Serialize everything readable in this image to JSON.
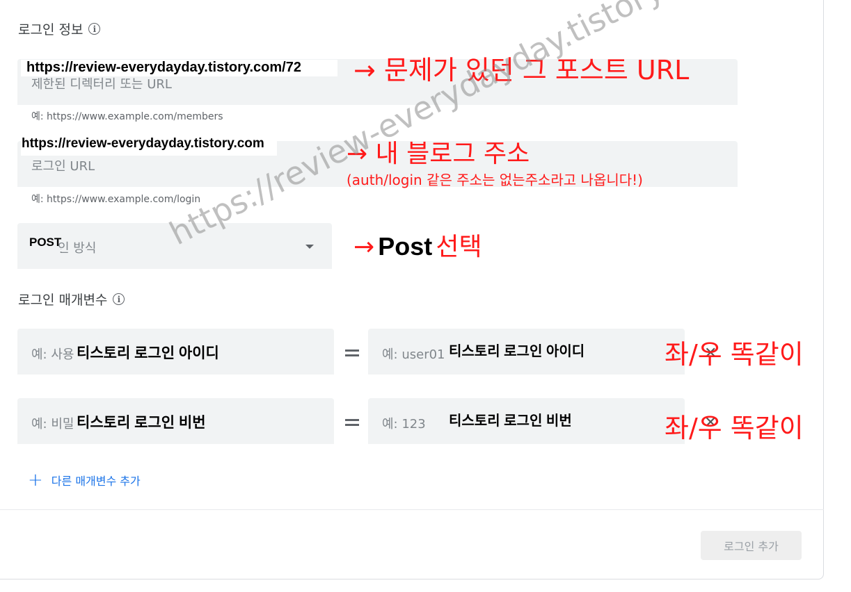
{
  "login_info": {
    "title": "로그인 정보",
    "restricted_dir": {
      "placeholder": "제한된 디렉터리 또는 URL",
      "helper": "예: https://www.example.com/members",
      "overlay_value": "https://review-everydayday.tistory.com/72",
      "annotation": "→ 문제가 있던 그 포스트 URL"
    },
    "login_url": {
      "placeholder": "로그인 URL",
      "helper": "예: https://www.example.com/login",
      "overlay_value": "https://review-everydayday.tistory.com",
      "annotation": "→ 내 블로그 주소",
      "annotation_note": "(auth/login 같은 주소는 없는주소라고 나옵니다!)"
    },
    "login_method": {
      "placeholder_visible": "인 방식",
      "overlay_value": "POST",
      "annotation_arrow": "→",
      "annotation_bold": "Post",
      "annotation_red": "선택"
    }
  },
  "login_params": {
    "title": "로그인 매개변수",
    "rows": [
      {
        "left_placeholder": "예: 사용",
        "left_overlay": "티스토리 로그인 아이디",
        "right_placeholder": "예: user01",
        "right_overlay": "티스토리 로그인 아이디",
        "annotation": "좌/우 똑같이"
      },
      {
        "left_placeholder": "예: 비밀",
        "left_overlay": "티스토리 로그인 비번",
        "right_placeholder": "예: 123",
        "right_overlay": "티스토리 로그인 비번",
        "annotation": "좌/우 똑같이"
      }
    ],
    "add_param_label": "다른 매개변수 추가"
  },
  "footer": {
    "add_login_label": "로그인 추가"
  },
  "watermark": "https://review-everydayday.tistory.com",
  "icons": {
    "info": "info-icon",
    "dropdown": "chevron-down-icon",
    "plus": "plus-icon",
    "equals": "equals-icon",
    "close": "close-icon"
  },
  "colors": {
    "annotation_red": "#ff1a1a",
    "link_blue": "#1a73e8",
    "field_bg": "#f1f3f4"
  }
}
